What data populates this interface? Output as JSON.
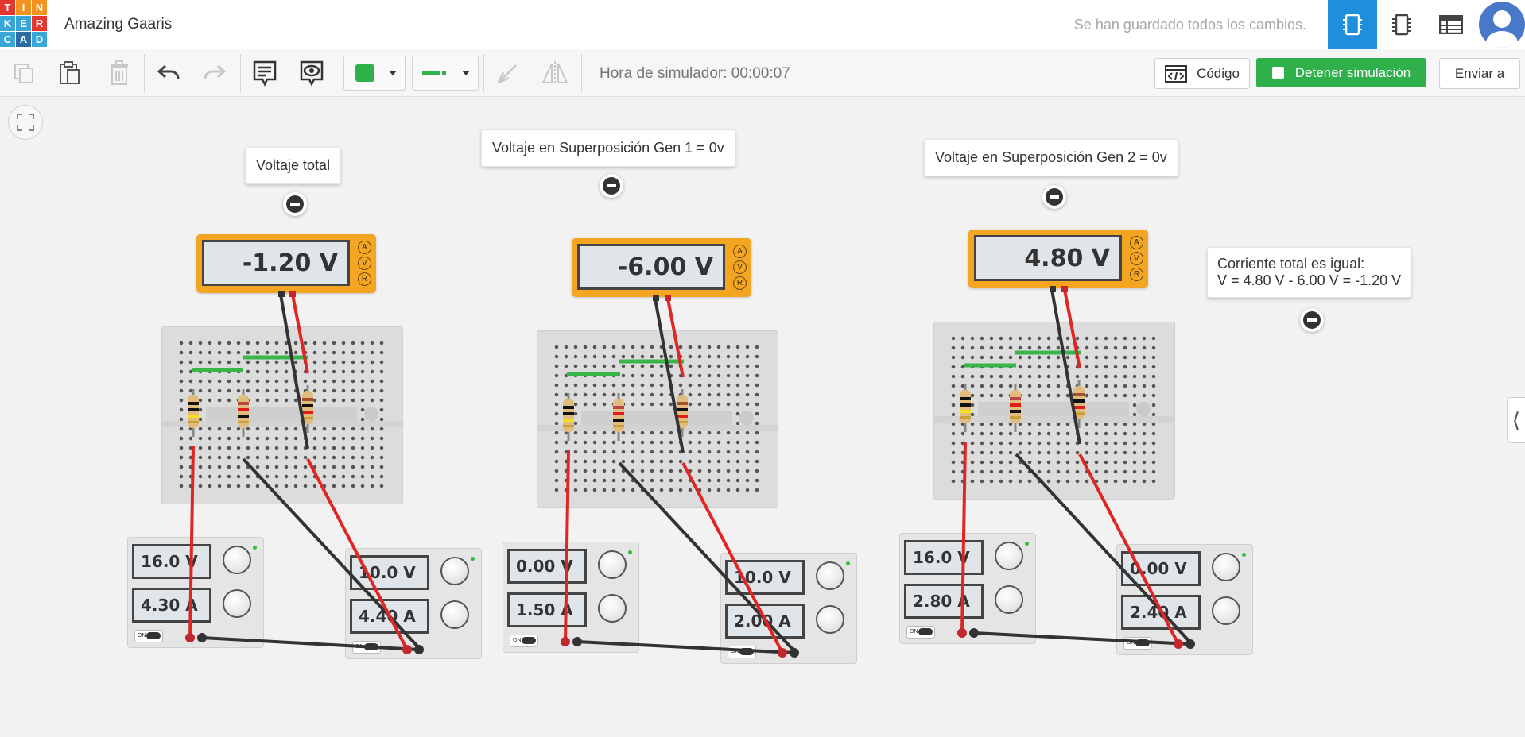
{
  "app": {
    "logo_letters": [
      "T",
      "I",
      "N",
      "K",
      "E",
      "R",
      "C",
      "A",
      "D"
    ],
    "logo_colors": [
      "#e4352f",
      "#f39220",
      "#f39220",
      "#39a6d8",
      "#39a6d8",
      "#e4352f",
      "#39a6d8",
      "#2e6ba6",
      "#39a6d8"
    ],
    "project_title": "Amazing Gaaris",
    "save_status": "Se han guardado todos los cambios.",
    "icons": {
      "circuit_view": "breadboard-icon",
      "component_list": "chip-icon",
      "schematic": "table-icon",
      "profile": "user-avatar-icon"
    }
  },
  "toolbar": {
    "tools": [
      "copy-icon",
      "paste-icon",
      "delete-icon",
      "undo-icon",
      "redo-icon",
      "note-icon",
      "eye-icon",
      "color-picker",
      "wire-type-picker",
      "rotate-icon",
      "mirror-icon"
    ],
    "wire_color": "#2fb04a",
    "sim_time_label": "Hora de simulador: 00:00:07",
    "code_label": "Código",
    "stop_label": "Detener simulación",
    "send_label": "Enviar a"
  },
  "canvas": {
    "notes": [
      {
        "text": "Voltaje total"
      },
      {
        "text": "Voltaje en Superposición Gen 1 = 0v"
      },
      {
        "text": "Voltaje en Superposición Gen 2 = 0v"
      },
      {
        "line1": "Corriente total es igual:",
        "line2": "V = 4.80 V - 6.00 V = -1.20 V"
      }
    ],
    "multimeters": [
      {
        "reading": "-1.20 V",
        "modes": [
          "A",
          "V",
          "R"
        ]
      },
      {
        "reading": "-6.00 V",
        "modes": [
          "A",
          "V",
          "R"
        ]
      },
      {
        "reading": "4.80 V",
        "modes": [
          "A",
          "V",
          "R"
        ]
      }
    ],
    "power_supplies": [
      {
        "voltage": "16.0 V",
        "current": "4.30 A"
      },
      {
        "voltage": "10.0 V",
        "current": "4.40 A"
      },
      {
        "voltage": "0.00 V",
        "current": "1.50 A"
      },
      {
        "voltage": "10.0 V",
        "current": "2.00 A"
      },
      {
        "voltage": "16.0 V",
        "current": "2.80 A"
      },
      {
        "voltage": "0.00 V",
        "current": "2.40 A"
      }
    ],
    "switch_label": "ON"
  }
}
